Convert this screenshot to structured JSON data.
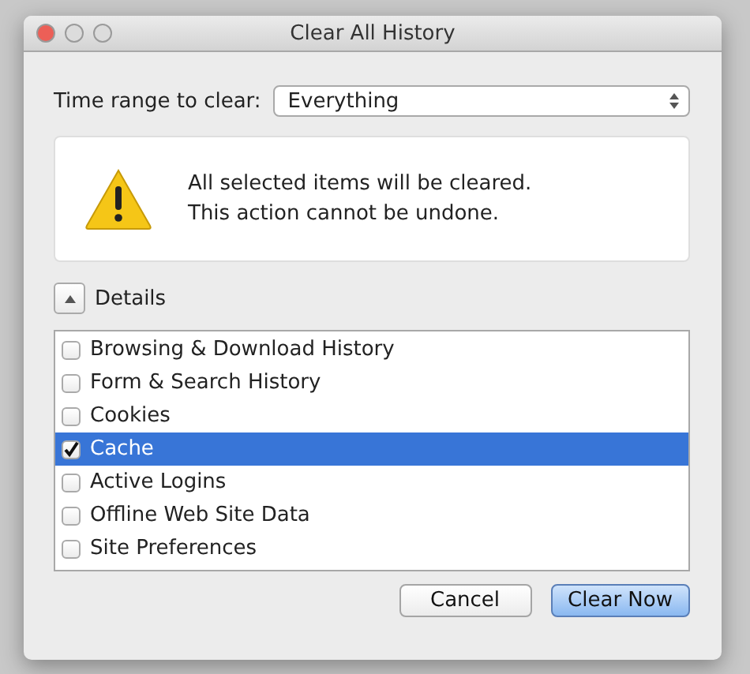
{
  "window": {
    "title": "Clear All History"
  },
  "time_range": {
    "label": "Time range to clear:",
    "value": "Everything"
  },
  "warning": {
    "lines": [
      "All selected items will be cleared.",
      "This action cannot be undone."
    ]
  },
  "details": {
    "label": "Details",
    "expanded": true
  },
  "items": [
    {
      "label": "Browsing & Download History",
      "checked": false,
      "selected": false
    },
    {
      "label": "Form & Search History",
      "checked": false,
      "selected": false
    },
    {
      "label": "Cookies",
      "checked": false,
      "selected": false
    },
    {
      "label": "Cache",
      "checked": true,
      "selected": true
    },
    {
      "label": "Active Logins",
      "checked": false,
      "selected": false
    },
    {
      "label": "Offline Web Site Data",
      "checked": false,
      "selected": false
    },
    {
      "label": "Site Preferences",
      "checked": false,
      "selected": false
    }
  ],
  "buttons": [
    {
      "label": "Cancel",
      "default": false
    },
    {
      "label": "Clear Now",
      "default": true
    }
  ]
}
